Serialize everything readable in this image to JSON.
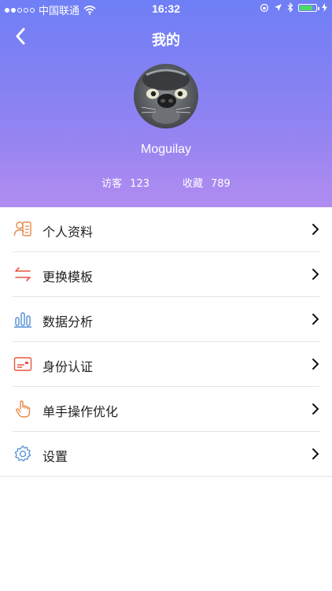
{
  "status_bar": {
    "carrier": "中国联通",
    "time": "16:32"
  },
  "nav": {
    "title": "我的"
  },
  "profile": {
    "username": "Moguilay",
    "visitors_label": "访客",
    "visitors_count": "123",
    "favorites_label": "收藏",
    "favorites_count": "789"
  },
  "menu": [
    {
      "label": "个人资料",
      "icon": "profile-card-icon",
      "color": "#e8894a"
    },
    {
      "label": "更换模板",
      "icon": "swap-arrows-icon",
      "color": "#e8553d"
    },
    {
      "label": "数据分析",
      "icon": "bar-chart-icon",
      "color": "#4f8fd6"
    },
    {
      "label": "身份认证",
      "icon": "id-card-icon",
      "color": "#e8553d"
    },
    {
      "label": "单手操作优化",
      "icon": "hand-pointer-icon",
      "color": "#e8894a"
    },
    {
      "label": "设置",
      "icon": "gear-icon",
      "color": "#4f8fd6"
    }
  ]
}
